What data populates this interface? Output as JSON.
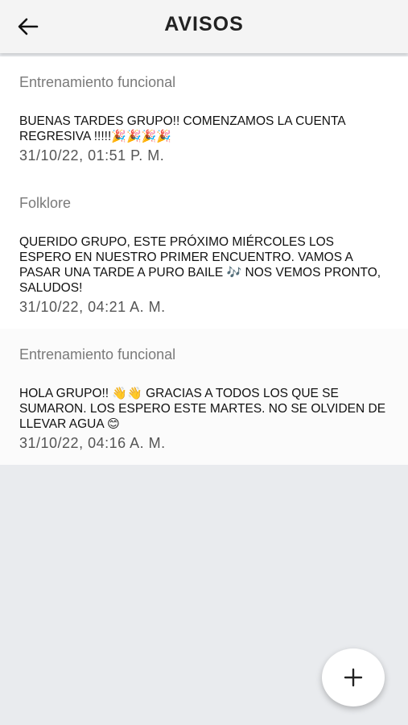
{
  "header": {
    "title": "AVISOS",
    "back_icon": "arrow-left-icon"
  },
  "notices": [
    {
      "group": "Entrenamiento funcional",
      "message": "BUENAS TARDES GRUPO!! COMENZAMOS LA CUENTA REGRESIVA !!!!!",
      "emoji": "🎉🎉🎉🎉",
      "date": "31/10/22, 01:51 P. M."
    },
    {
      "group": "Folklore",
      "message": "QUERIDO GRUPO, ESTE PRÓXIMO MIÉRCOLES LOS ESPERO EN NUESTRO PRIMER ENCUENTRO. VAMOS A PASAR UNA TARDE A PURO BAILE ",
      "emoji": "🎶",
      "message_tail": " NOS VEMOS PRONTO, SALUDOS!",
      "date": "31/10/22, 04:21 A. M."
    },
    {
      "group": "Entrenamiento funcional",
      "message": "HOLA GRUPO!! ",
      "emoji": "👋👋",
      "message_tail": " GRACIAS A TODOS LOS QUE SE SUMARON. LOS ESPERO ESTE MARTES. NO SE OLVIDEN DE LLEVAR AGUA ",
      "emoji_tail": "😊",
      "date": "31/10/22, 04:16 A. M."
    }
  ],
  "fab": {
    "icon": "plus-icon"
  }
}
